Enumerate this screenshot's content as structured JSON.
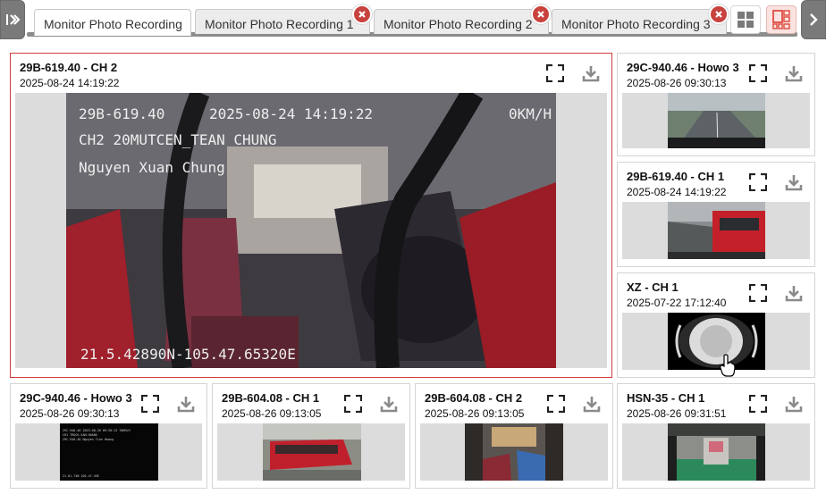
{
  "tabs": [
    {
      "label": "Monitor Photo Recording",
      "active": true,
      "closable": false
    },
    {
      "label": "Monitor Photo Recording 1",
      "active": false,
      "closable": true
    },
    {
      "label": "Monitor Photo Recording 2",
      "active": false,
      "closable": true
    },
    {
      "label": "Monitor Photo Recording 3",
      "active": false,
      "closable": true
    }
  ],
  "icons": {
    "expand": "expand-left-icon",
    "collapse": "collapse-right-icon",
    "grid": "grid-layout-icon",
    "split": "split-layout-icon",
    "close": "close-icon",
    "fullscreen": "fullscreen-icon",
    "download": "download-icon"
  },
  "colors": {
    "selected_border": "#d23b3b",
    "tab_close": "#c8423e",
    "split_layout_accent": "#e05a50"
  },
  "main": {
    "title": "29B-619.40 - CH 2",
    "time": "2025-08-24 14:19:22",
    "overlay": {
      "line1_plate": "29B-619.40",
      "line1_datetime": "2025-08-24 14:19:22",
      "line1_speed": "0KM/H",
      "line2": "CH2 20MUTCEN_TEAN CHUNG",
      "line3": "Nguyen Xuan Chung",
      "coords": "21.5.42890N-105.47.65320E"
    }
  },
  "side_cards": [
    {
      "title": "29C-940.46 - Howo 3",
      "time": "2025-08-26 09:30:13",
      "thumb": "road"
    },
    {
      "title": "29B-619.40 - CH 1",
      "time": "2025-08-24 14:19:22",
      "thumb": "bus-street"
    },
    {
      "title": "XZ - CH 1",
      "time": "2025-07-22 17:12:40",
      "thumb": "fisheye"
    }
  ],
  "bottom_cards": [
    {
      "title": "29C-940.46 - Howo 3",
      "time": "2025-08-26 09:30:13",
      "thumb": "dark-text",
      "mini_text": [
        "29C-940.46 2025-08-26 09:30:13  70KM/H",
        "CH1 TRUCK-VAN-HOANG",
        "29C-940.46 Nguyen Tien Hoang",
        "21.01.74N 105.47.45E"
      ]
    },
    {
      "title": "29B-604.08 - CH 1",
      "time": "2025-08-26 09:13:05",
      "thumb": "red-bus"
    },
    {
      "title": "29B-604.08 - CH 2",
      "time": "2025-08-26 09:13:05",
      "thumb": "interior"
    },
    {
      "title": "HSN-35 - CH 1",
      "time": "2025-08-26 09:31:51",
      "thumb": "garage"
    }
  ]
}
